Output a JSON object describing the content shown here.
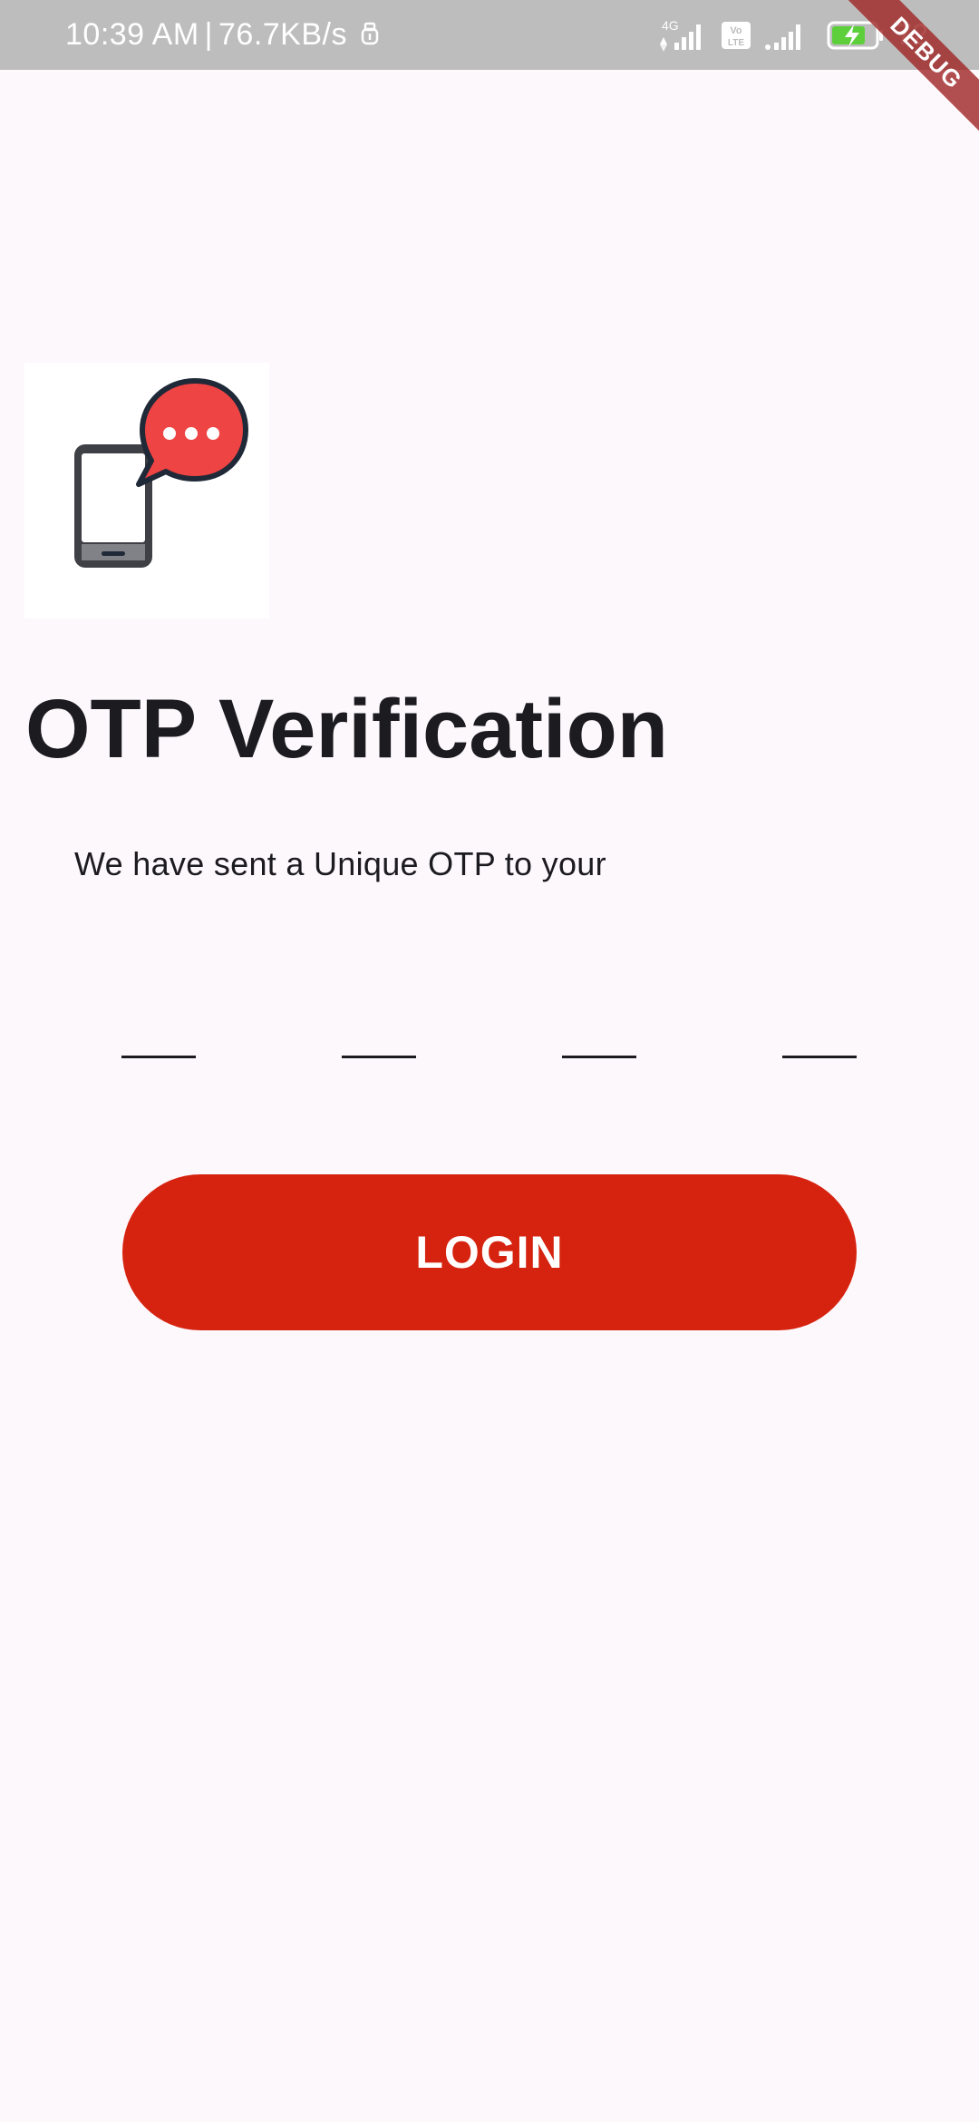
{
  "status_bar": {
    "time": "10:39 AM",
    "separator": "|",
    "network_speed": "76.7KB/s",
    "usb_icon": "usb-debug-icon",
    "signal_1_label": "4G",
    "volte_label": "Vo LTE",
    "battery_percent": "72"
  },
  "debug_banner": {
    "label": "DEBUG"
  },
  "illustration": {
    "icon": "phone-message-icon",
    "bubble_color": "#ef4444",
    "phone_color": "#3f3f46"
  },
  "page": {
    "title": "OTP Verification",
    "subtitle": "We have sent a Unique OTP to your"
  },
  "otp": {
    "fields": [
      "",
      "",
      "",
      ""
    ]
  },
  "login": {
    "label": "LOGIN",
    "color": "#d6230f"
  }
}
